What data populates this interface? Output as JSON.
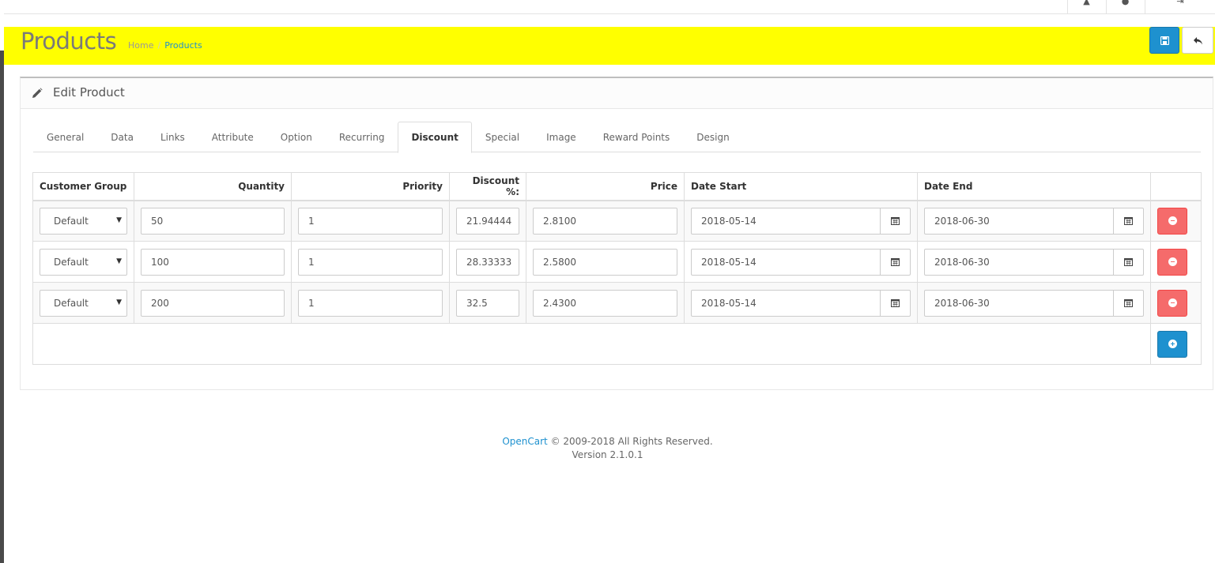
{
  "header": {
    "title": "Products",
    "breadcrumb": [
      {
        "label": "Home"
      },
      {
        "label": "Products"
      }
    ],
    "breadcrumb_sep": "/"
  },
  "panel": {
    "title": "Edit Product"
  },
  "tabs": [
    {
      "label": "General"
    },
    {
      "label": "Data"
    },
    {
      "label": "Links"
    },
    {
      "label": "Attribute"
    },
    {
      "label": "Option"
    },
    {
      "label": "Recurring"
    },
    {
      "label": "Discount",
      "active": true
    },
    {
      "label": "Special"
    },
    {
      "label": "Image"
    },
    {
      "label": "Reward Points"
    },
    {
      "label": "Design"
    }
  ],
  "table": {
    "columns": [
      "Customer Group",
      "Quantity",
      "Priority",
      "Discount %:",
      "Price",
      "Date Start",
      "Date End"
    ],
    "rows": [
      {
        "group": "Default",
        "quantity": "50",
        "priority": "1",
        "discount": "21.94444",
        "price": "2.8100",
        "date_start": "2018-05-14",
        "date_end": "2018-06-30"
      },
      {
        "group": "Default",
        "quantity": "100",
        "priority": "1",
        "discount": "28.33333",
        "price": "2.5800",
        "date_start": "2018-05-14",
        "date_end": "2018-06-30"
      },
      {
        "group": "Default",
        "quantity": "200",
        "priority": "1",
        "discount": "32.5",
        "price": "2.4300",
        "date_start": "2018-05-14",
        "date_end": "2018-06-30"
      }
    ]
  },
  "footer": {
    "brand": "OpenCart",
    "copyright": " © 2009-2018 All Rights Reserved.",
    "version": "Version 2.1.0.1"
  },
  "colors": {
    "header_bg": "#ffff00",
    "primary": "#1e91cf",
    "danger": "#f56b6b"
  }
}
